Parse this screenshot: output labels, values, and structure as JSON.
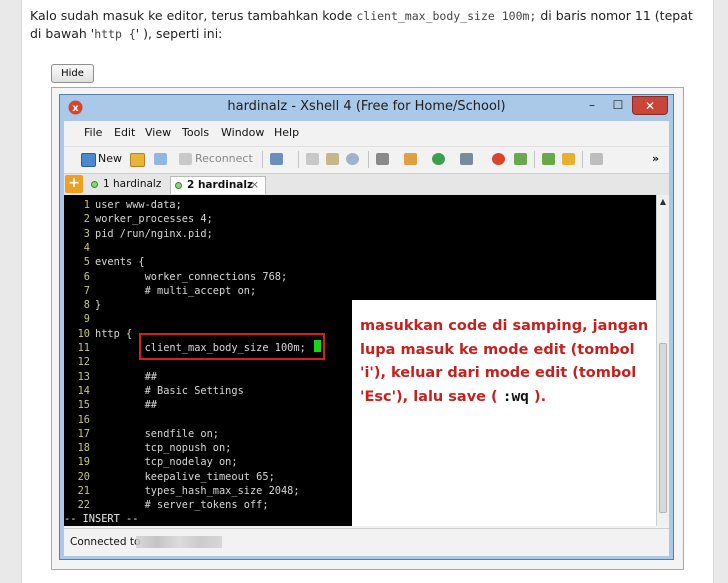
{
  "intro": {
    "text1": "Kalo sudah masuk ke editor, terus tambahkan kode ",
    "code1": "client_max_body_size 100m;",
    "text2": " di baris nomor 11 (tepat di bawah '",
    "code2": "http {",
    "text3": "' ), seperti ini:"
  },
  "hide_label": "Hide",
  "window": {
    "title": "hardinalz - Xshell 4 (Free for Home/School)",
    "min_label": "–",
    "max_label": "☐",
    "close_label": "✕"
  },
  "menu": [
    "File",
    "Edit",
    "View",
    "Tools",
    "Window",
    "Help"
  ],
  "toolbar": {
    "new_label": "New",
    "reconnect_label": "Reconnect",
    "more_label": "»"
  },
  "tabs": [
    {
      "label": "1 hardinalz",
      "active": false
    },
    {
      "label": "2 hardinalz",
      "active": true,
      "close": "×"
    }
  ],
  "tab_add_label": "+",
  "terminal": {
    "lines": [
      {
        "n": "1",
        "t": "user www-data;"
      },
      {
        "n": "2",
        "t": "worker_processes 4;"
      },
      {
        "n": "3",
        "t": "pid /run/nginx.pid;"
      },
      {
        "n": "4",
        "t": ""
      },
      {
        "n": "5",
        "t": "events {"
      },
      {
        "n": "6",
        "t": "        worker_connections 768;"
      },
      {
        "n": "7",
        "t": "        # multi_accept on;"
      },
      {
        "n": "8",
        "t": "}"
      },
      {
        "n": "9",
        "t": ""
      },
      {
        "n": "10",
        "t": "http {"
      },
      {
        "n": "11",
        "t": "        client_max_body_size 100m;"
      },
      {
        "n": "12",
        "t": ""
      },
      {
        "n": "13",
        "t": "        ##"
      },
      {
        "n": "14",
        "t": "        # Basic Settings"
      },
      {
        "n": "15",
        "t": "        ##"
      },
      {
        "n": "16",
        "t": ""
      },
      {
        "n": "17",
        "t": "        sendfile on;"
      },
      {
        "n": "18",
        "t": "        tcp_nopush on;"
      },
      {
        "n": "19",
        "t": "        tcp_nodelay on;"
      },
      {
        "n": "20",
        "t": "        keepalive_timeout 65;"
      },
      {
        "n": "21",
        "t": "        types_hash_max_size 2048;"
      },
      {
        "n": "22",
        "t": "        # server_tokens off;"
      }
    ],
    "mode": "-- INSERT --"
  },
  "note": {
    "text": "masukkan code di samping, jangan lupa masuk ke mode edit (tombol 'i'), keluar dari mode edit (tombol 'Esc'), lalu save ( ",
    "cmd": ":wq",
    "end": " )."
  },
  "status": {
    "label": "Connected to"
  },
  "colors": {
    "note_text": "#c8201e",
    "highlight_box": "#d42020",
    "cursor": "#18d318",
    "terminal_bg": "#000000",
    "line_number": "#c7c777"
  }
}
